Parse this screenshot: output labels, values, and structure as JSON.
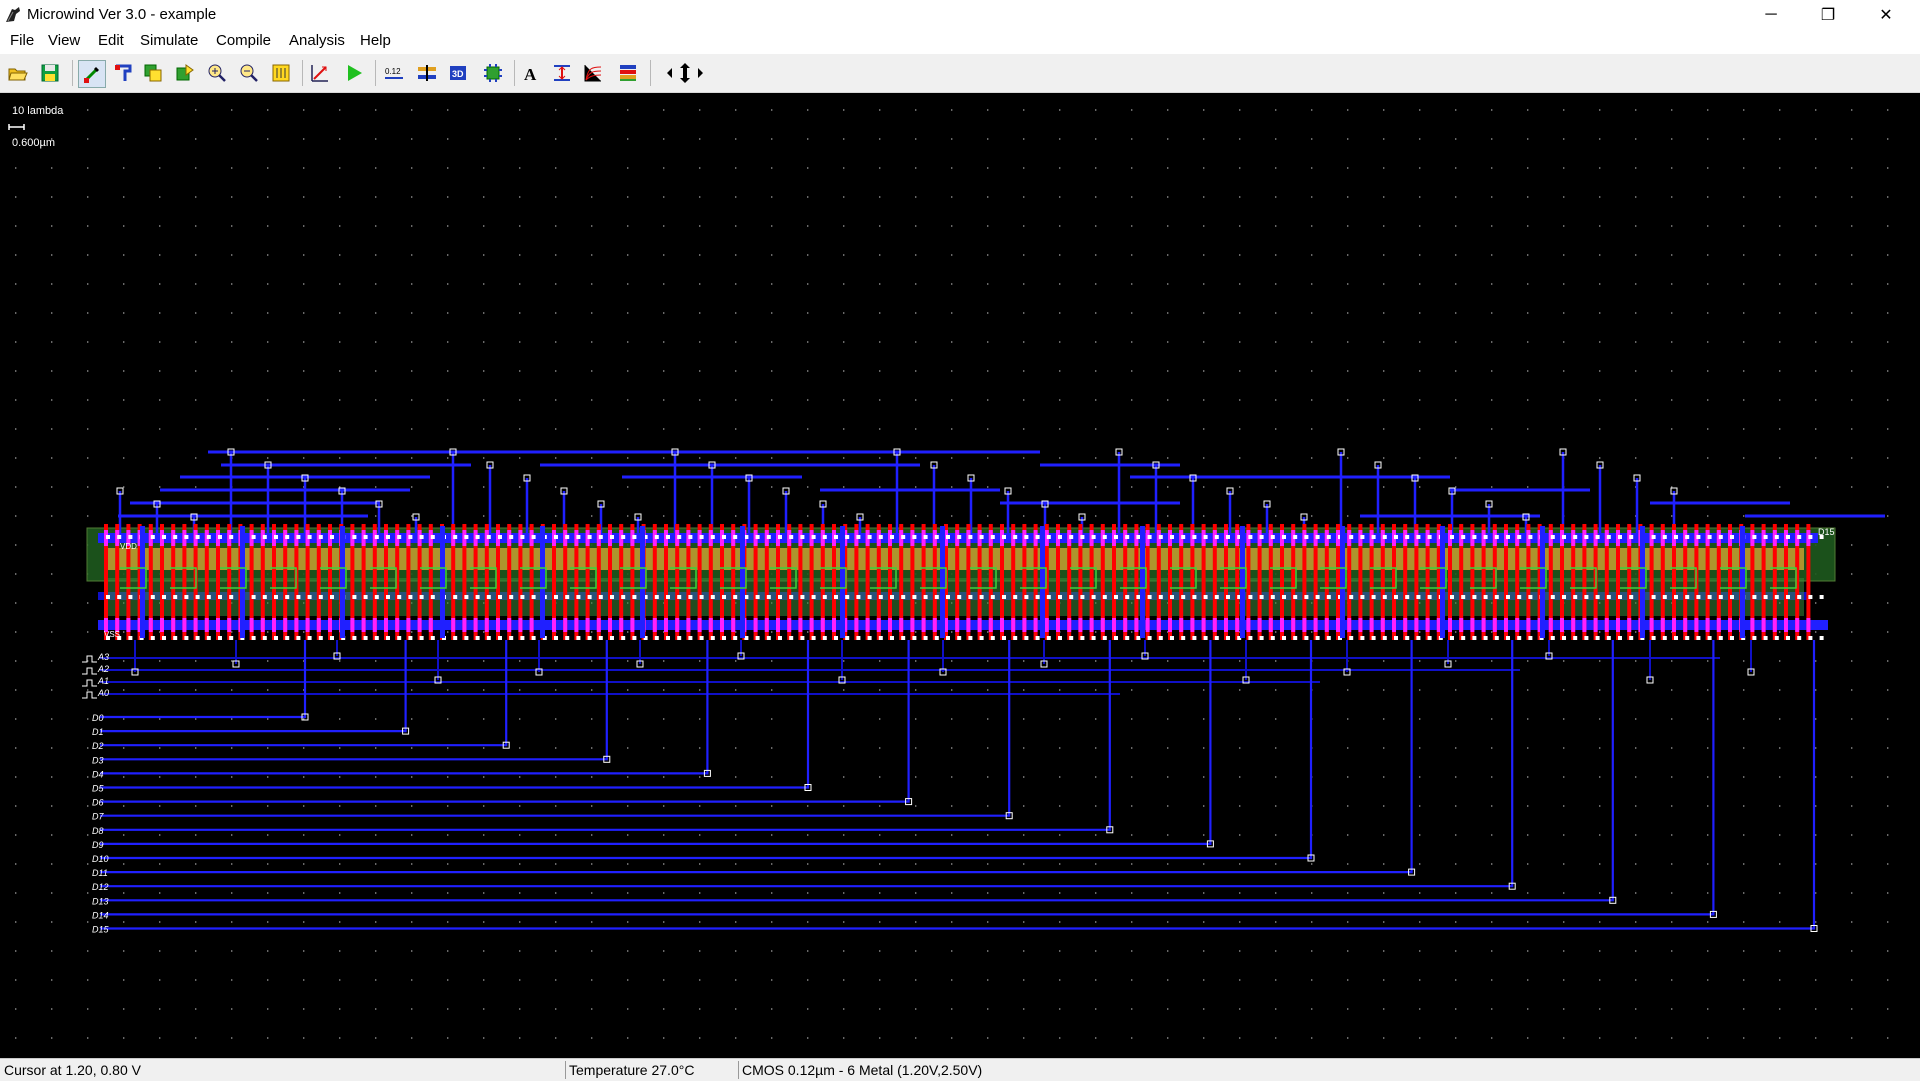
{
  "window": {
    "title": "Microwind Ver 3.0 - example",
    "controls": {
      "minimize": "─",
      "restore": "❐",
      "close": "✕"
    }
  },
  "menu": [
    "File",
    "View",
    "Edit",
    "Simulate",
    "Compile",
    "Analysis",
    "Help"
  ],
  "toolbar": {
    "buttons": [
      {
        "name": "open-icon"
      },
      {
        "name": "save-icon"
      },
      {
        "name": "draw-box-icon"
      },
      {
        "name": "draw-connect-icon"
      },
      {
        "name": "copy-icon"
      },
      {
        "name": "move-icon"
      },
      {
        "name": "zoom-in-icon"
      },
      {
        "name": "zoom-out-icon"
      },
      {
        "name": "view-all-icon"
      },
      {
        "name": "measure-icon"
      },
      {
        "name": "run-simulation-icon"
      },
      {
        "name": "mos-generator-icon"
      },
      {
        "name": "via-icon"
      },
      {
        "name": "3d-view-icon"
      },
      {
        "name": "chip-icon"
      },
      {
        "name": "add-text-icon"
      },
      {
        "name": "cross-section-icon"
      },
      {
        "name": "characteristics-icon"
      },
      {
        "name": "layers-icon"
      },
      {
        "name": "pan-arrows-icon"
      }
    ]
  },
  "canvas": {
    "scale_label": "10 lambda",
    "scale_value": "0.600µm",
    "top_right_label": "D15",
    "vdd_label": "VDD",
    "vss_label": "VSS",
    "input_labels": [
      "A3",
      "A2",
      "A1",
      "A0"
    ],
    "bus_labels": [
      "D0",
      "D1",
      "D2",
      "D3",
      "D4",
      "D5",
      "D6",
      "D7",
      "D8",
      "D9",
      "D10",
      "D11",
      "D12",
      "D13",
      "D14",
      "D15"
    ],
    "colors": {
      "background": "#000000",
      "metal": "#1010c8",
      "metal_bright": "#2020ff",
      "poly": "#ff0000",
      "diffusion": "#c8a030",
      "contact": "#ffffff",
      "nwell": "#5a8a3a",
      "well_fill": "#1e5a1e",
      "grid_dot": "#8a8a8a"
    }
  },
  "status": {
    "cursor": "Cursor at 1.20, 0.80 V",
    "temperature": "Temperature 27.0°C",
    "technology": "CMOS 0.12µm - 6 Metal (1.20V,2.50V)"
  }
}
